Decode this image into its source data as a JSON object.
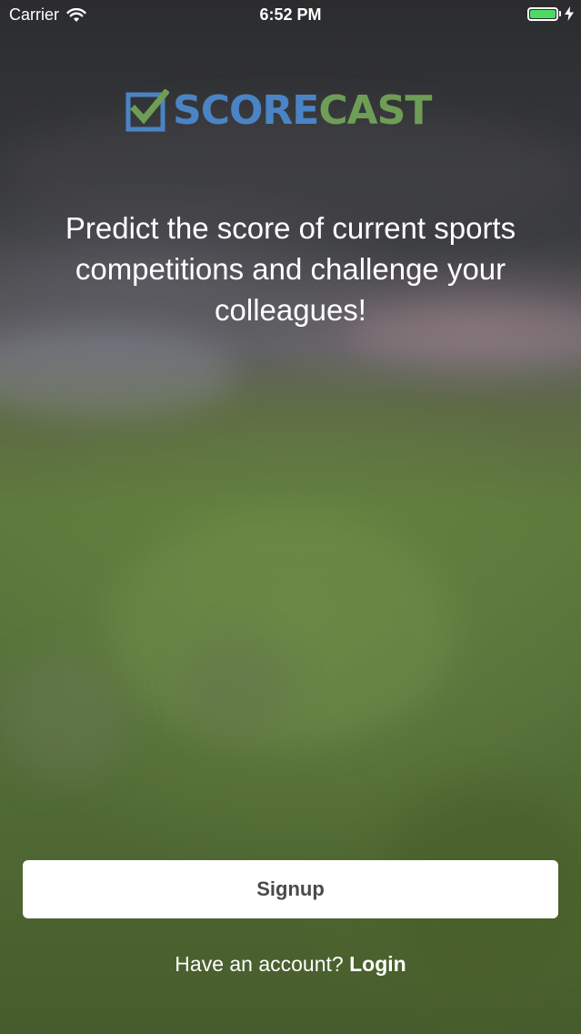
{
  "status_bar": {
    "carrier": "Carrier",
    "time": "6:52 PM",
    "wifi_icon": "wifi-icon",
    "battery_icon": "battery-charging-icon",
    "battery_color": "#4cd964"
  },
  "logo": {
    "icon": "checkbox-checked-icon",
    "text_part1": "SCORE",
    "text_part2": "CAST",
    "color_part1": "#4b84c5",
    "color_part2": "#6e9e55"
  },
  "tagline": "Predict the score of current sports competitions and challenge your colleagues!",
  "signup_label": "Signup",
  "login": {
    "prompt": "Have an account?",
    "link_label": "Login"
  }
}
